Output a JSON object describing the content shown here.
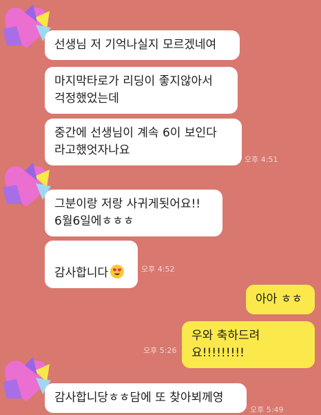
{
  "colors": {
    "background": "#d8786f",
    "incoming_bubble": "#ffffff",
    "outgoing_bubble": "#fbe94c",
    "timestamp": "#f3d7d2"
  },
  "messages": {
    "m1": "선생님 저 기억나실지 모르겠네여",
    "m2": "마지막타로가 리딩이 좋지않아서\n걱정했었는데",
    "m3": "중간에 선생님이 계속 6이 보인다\n라고했엇자나요",
    "t1": "오후 4:51",
    "m4": "그분이랑 저랑 사귀게됫어요!!\n6월6일에ㅎㅎㅎ",
    "m5": "감사합니다",
    "t2": "오후 4:52",
    "m6": "아아 ㅎㅎ",
    "m7": "우와 축하드려요!!!!!!!!!",
    "t3": "오후 5:26",
    "m8": "감사합니당ㅎㅎ담에 또 찾아뵈께영",
    "t4": "오후 5:49"
  },
  "icons": {
    "avatar": "heart-avatar-icon",
    "emoji": "heart-eyes-emoji-icon"
  }
}
